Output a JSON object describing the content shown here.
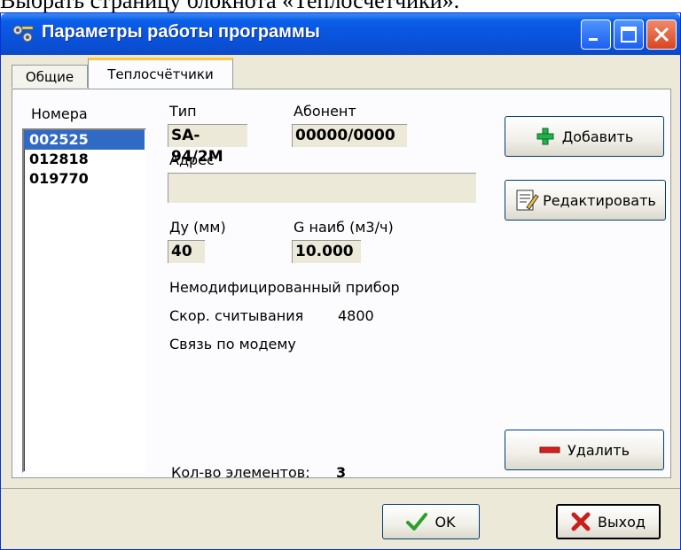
{
  "caption_text": "Выбрать страницу блокнота «Теплосчётчики».",
  "window": {
    "title": "Параметры работы программы"
  },
  "tabs": [
    {
      "label": "Общие",
      "active": false
    },
    {
      "label": "Теплосчётчики",
      "active": true
    }
  ],
  "numbers": {
    "label": "Номера",
    "items": [
      "002525",
      "012818",
      "019770"
    ],
    "selected": "002525"
  },
  "details": {
    "type_label": "Тип",
    "type_value": "SA-94/2M",
    "subscriber_label": "Абонент",
    "subscriber_value": "00000/0000",
    "address_label": "Адрес",
    "address_value": "",
    "du_label": "Ду (мм)",
    "du_value": "40",
    "g_label": "G наиб (м3/ч)",
    "g_value": "10.000",
    "device_status": "Немодифицированный прибор",
    "speed_label": "Скор. считывания",
    "speed_value": "4800",
    "connection": "Связь по модему",
    "count_label": "Кол-во элементов:",
    "count_value": "3"
  },
  "buttons": {
    "add": "Добавить",
    "edit": "Редактировать",
    "delete": "Удалить",
    "ok": "OK",
    "exit": "Выход"
  },
  "colors": {
    "titlebar": "#0a54de",
    "selection": "#316ac5",
    "add_icon": "#22b14c",
    "delete_icon": "#d42020",
    "ok_icon": "#2aa02a",
    "exit_icon": "#c81e1e"
  },
  "icons": {
    "title": "settings-icon",
    "add": "plus-icon",
    "edit": "edit-document-icon",
    "delete": "minus-icon",
    "ok": "checkmark-icon",
    "exit": "x-icon"
  }
}
